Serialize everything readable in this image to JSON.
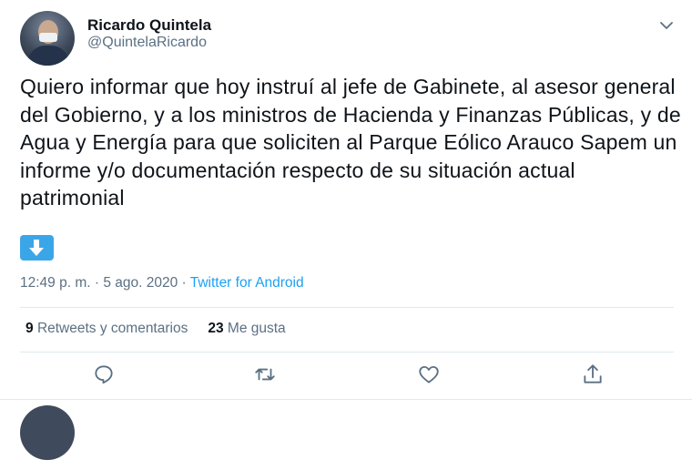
{
  "author": {
    "name": "Ricardo Quintela",
    "handle": "@QuintelaRicardo"
  },
  "tweet": {
    "text": "Quiero informar que hoy instruí al jefe de Gabinete, al asesor general del Gobierno, y a los ministros de Hacienda y Finanzas Públicas, y de Agua y Energía para que soliciten al Parque Eólico Arauco Sapem un informe y/o documentación respecto de su situación actual patrimonial",
    "emoji": "down-arrow-button-emoji",
    "timestamp": "12:49 p. m. · 5 ago. 2020 · ",
    "source": "Twitter for Android"
  },
  "stats": {
    "retweets_count": "9",
    "retweets_label": "Retweets y comentarios",
    "likes_count": "23",
    "likes_label": "Me gusta"
  },
  "actions": [
    "reply-icon",
    "retweet-icon",
    "like-icon",
    "share-icon"
  ],
  "colors": {
    "accent": "#1da1f2",
    "muted": "#5b7083",
    "emoji_bg": "#3aa6e8"
  }
}
